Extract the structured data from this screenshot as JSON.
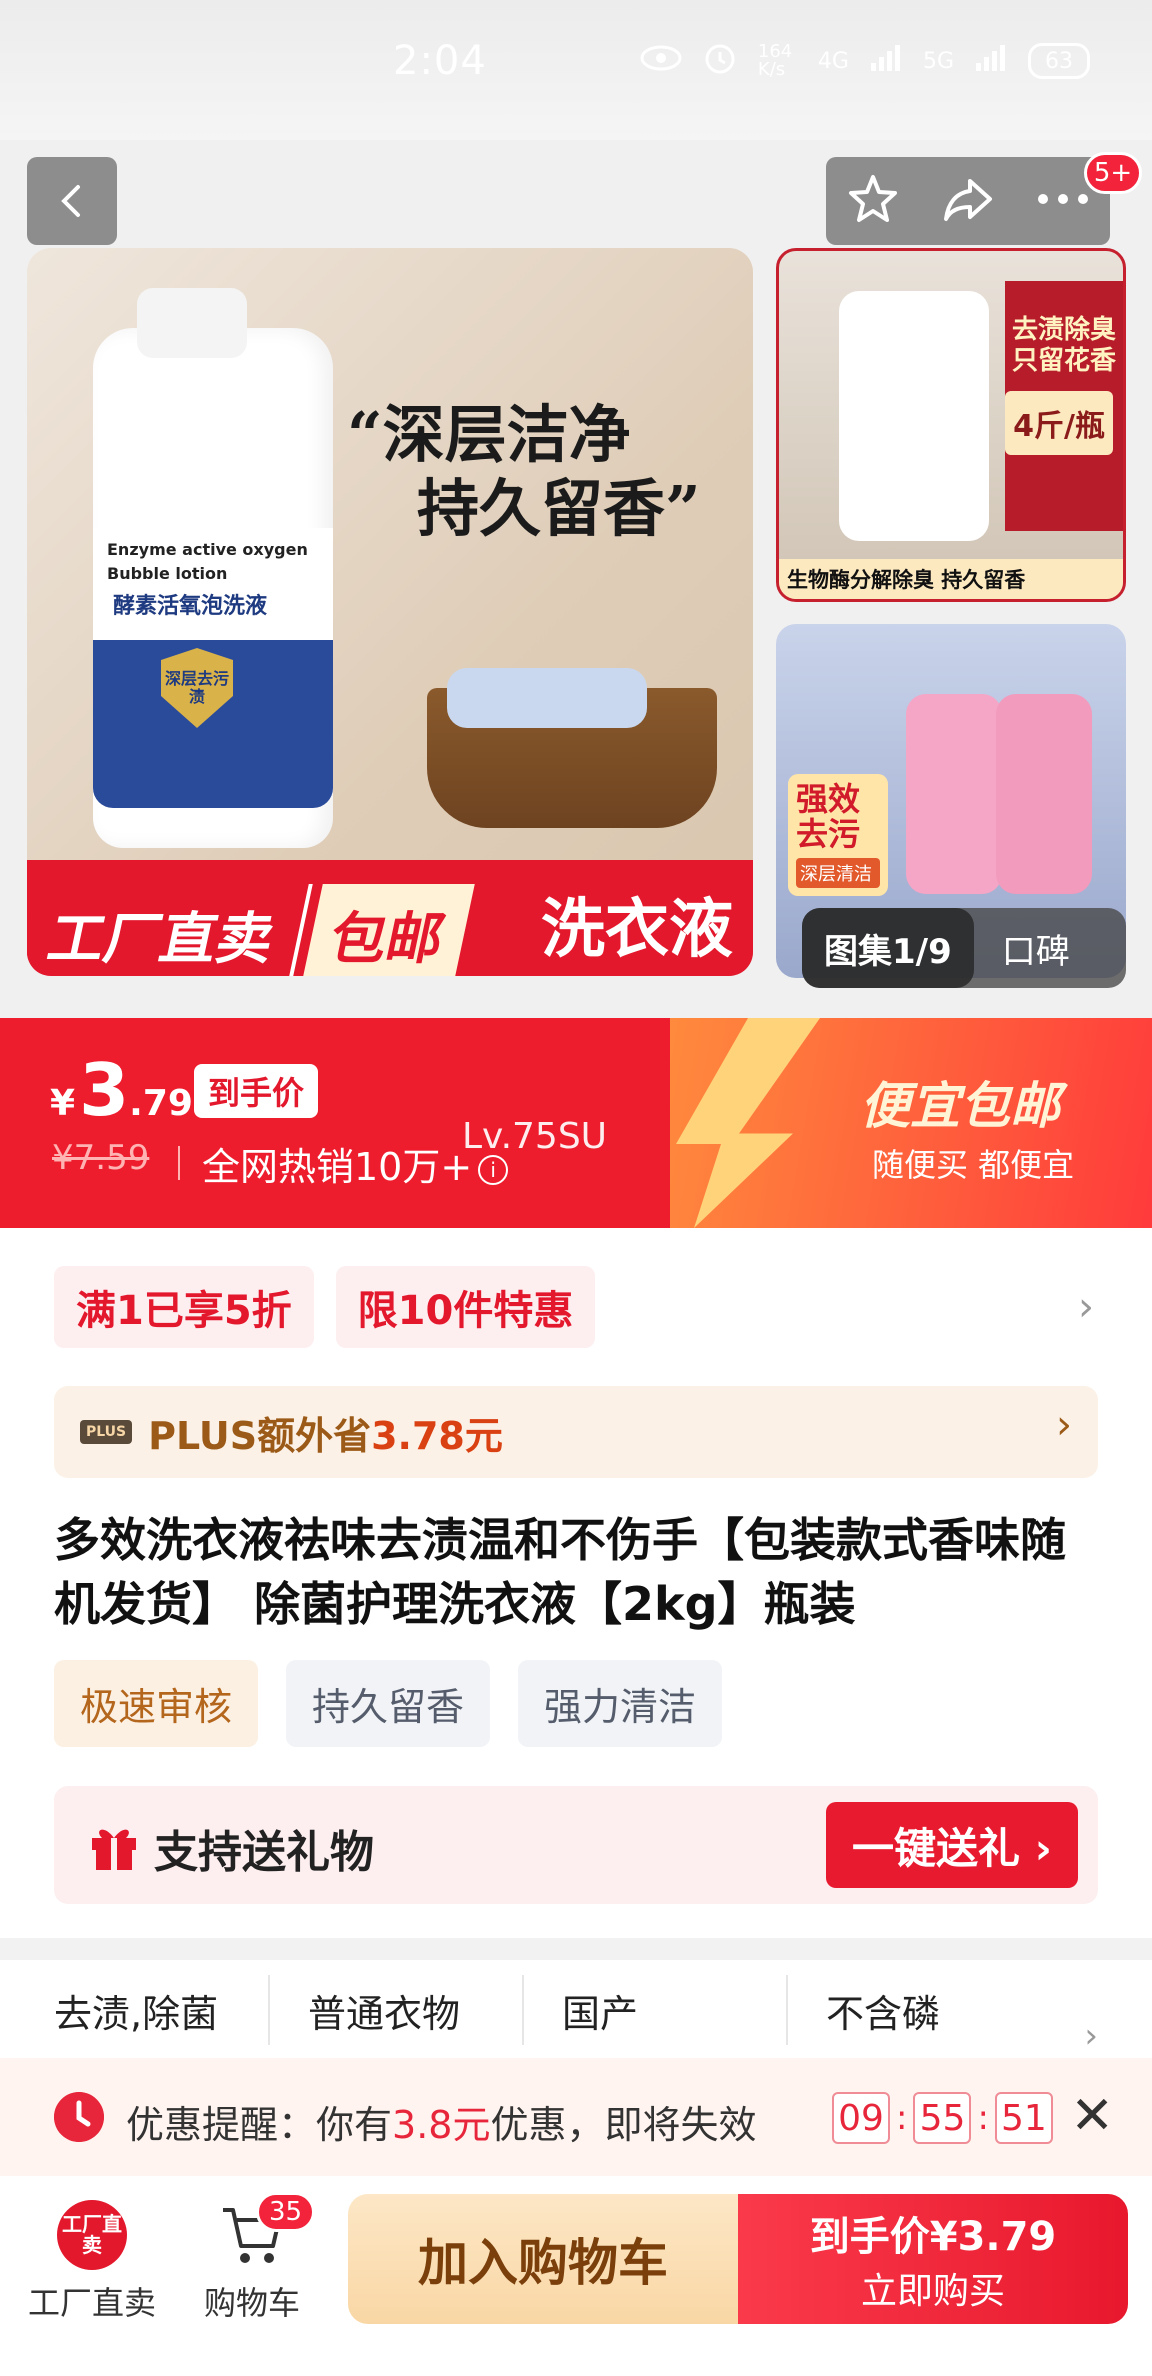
{
  "status_bar": {
    "time": "2:04",
    "speed": "164 K/s",
    "net1": "4G",
    "net2": "5G",
    "battery": "63"
  },
  "header": {
    "cart_badge": "5+"
  },
  "main_image": {
    "bottle_line1": "Enzyme active oxygen",
    "bottle_line2": "Bubble lotion",
    "bottle_line3": "酵素活氧泡洗液",
    "shield": "深层去污渍",
    "headline_1": "“深层洁净",
    "headline_2": "持久留香”",
    "banner_text": "洗衣液",
    "tag_factory": "工厂直卖",
    "tag_shipping": "包邮"
  },
  "thumb1": {
    "title": "去渍除臭只留花香",
    "weight": "4斤/瓶",
    "footer": "生物酶分解除臭 持久留香"
  },
  "thumb2": {
    "tag_title": "强效去污",
    "tag_sub": "深层清洁"
  },
  "gallery": {
    "counter": "图集1/9",
    "reviews": "口碑"
  },
  "price": {
    "currency": "¥",
    "integer": "3",
    "decimal": ".79",
    "label": "到手价",
    "original": "¥7.59",
    "hot_sales": "全网热销10万+",
    "lv": "Lv.75SU",
    "promo_title": "便宜包邮",
    "promo_sub": "随便买 都便宜"
  },
  "chips": [
    "满1已享5折",
    "限10件特惠"
  ],
  "plus": {
    "logo": "PLUS",
    "prefix": "PLUS额外省",
    "amount": "3.78元"
  },
  "title": "多效洗衣液祛味去渍温和不伤手【包装款式香味随机发货】 除菌护理洗衣液【2kg】瓶装",
  "tags": [
    "极速审核",
    "持久留香",
    "强力清洁"
  ],
  "gift": {
    "text": "支持送礼物",
    "button": "一键送礼 ›"
  },
  "props": [
    "去渍,除菌",
    "普通衣物",
    "国产",
    "不含磷"
  ],
  "reminder": {
    "prefix": "优惠提醒：你有",
    "amount": "3.8元",
    "suffix": "优惠，即将失效",
    "hours": "09",
    "minutes": "55",
    "seconds": "51"
  },
  "bottom_nav": {
    "factory_logo": "工厂直卖",
    "factory_label": "工厂直卖",
    "cart_label": "购物车",
    "cart_count": "35",
    "add_cart": "加入购物车",
    "buy_line1": "到手价¥3.79",
    "buy_line2": "立即购买"
  },
  "colors": {
    "brand_red": "#e3182d",
    "accent_orange": "#ff8a3d",
    "plus_brown": "#9b5a17"
  }
}
